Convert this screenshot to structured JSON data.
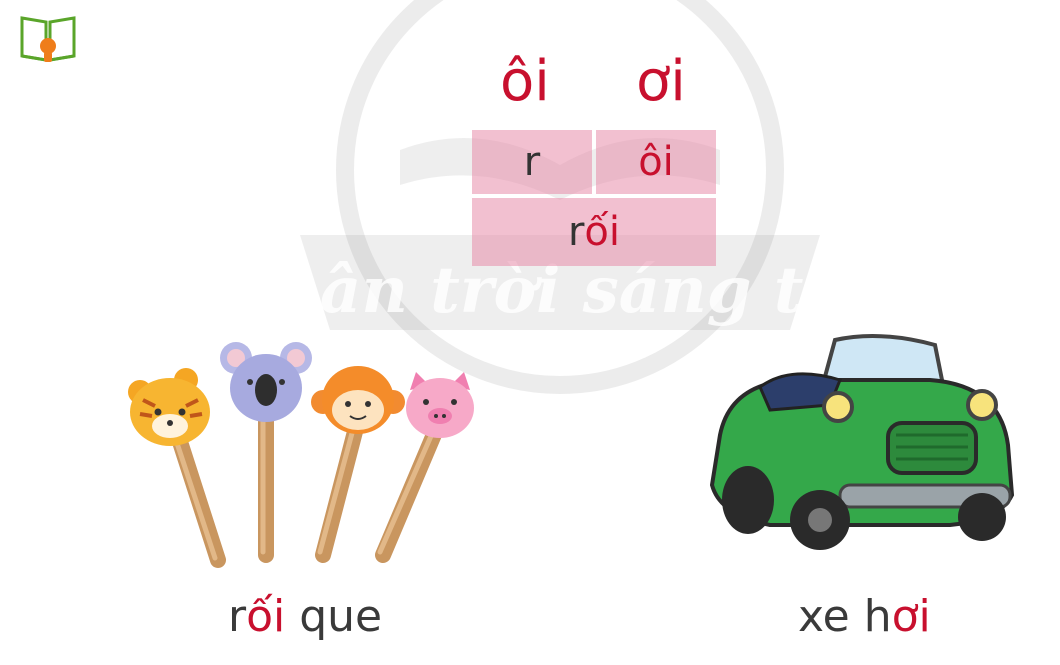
{
  "watermark": {
    "text": "Chân trời sáng tạo"
  },
  "icons": {
    "book": "book-icon",
    "puppets": "stick-puppets-illustration",
    "car": "green-car-illustration"
  },
  "vowels": [
    "ôi",
    "ơi"
  ],
  "spelling": {
    "consonant": "r",
    "rhyme": "ôi",
    "word_prefix": "r",
    "word_rhyme": "ối"
  },
  "examples": [
    {
      "plain": "r",
      "highlight": "ối",
      "rest": " que"
    },
    {
      "plain": "xe h",
      "highlight": "ơi",
      "rest": ""
    }
  ],
  "colors": {
    "accent": "#c8102e",
    "cell": "#e88caa",
    "watermark": "#d8d8d8",
    "book": "#5aa52a",
    "bulb": "#ef7d1a"
  }
}
